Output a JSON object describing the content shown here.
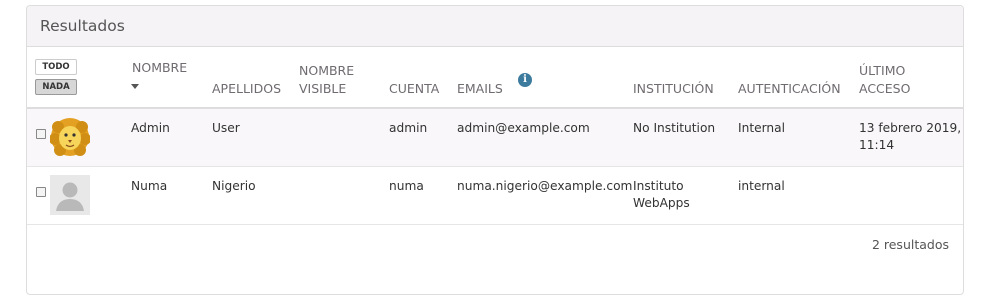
{
  "panel": {
    "title": "Resultados"
  },
  "select_buttons": {
    "all": "TODO",
    "none": "NADA"
  },
  "columns": {
    "nombre": "NOMBRE",
    "apellidos": "APELLIDOS",
    "nombre_visible_1": "NOMBRE",
    "nombre_visible_2": "VISIBLE",
    "cuenta": "CUENTA",
    "emails": "EMAILS",
    "institucion": "INSTITUCIÓN",
    "autenticacion": "AUTENTICACIÓN",
    "ultimo_1": "ÚLTIMO",
    "ultimo_2": "ACCESO"
  },
  "icons": {
    "sort": "sort-desc-icon",
    "info": "info-icon",
    "info_glyph": "i"
  },
  "rows": [
    {
      "nombre": "Admin",
      "apellidos": "User",
      "nombre_visible": "",
      "cuenta": "admin",
      "email": "admin@example.com",
      "institucion_1": "No Institution",
      "institucion_2": "",
      "autenticacion": "Internal",
      "ultimo_1": "13 febrero 2019,",
      "ultimo_2": "11:14",
      "avatar": "lion-avatar"
    },
    {
      "nombre": "Numa",
      "apellidos": "Nigerio",
      "nombre_visible": "",
      "cuenta": "numa",
      "email": "numa.nigerio@example.com",
      "institucion_1": "Instituto",
      "institucion_2": "WebApps",
      "autenticacion": "internal",
      "ultimo_1": "",
      "ultimo_2": "",
      "avatar": "default-user-avatar"
    }
  ],
  "results_count": "2 resultados"
}
